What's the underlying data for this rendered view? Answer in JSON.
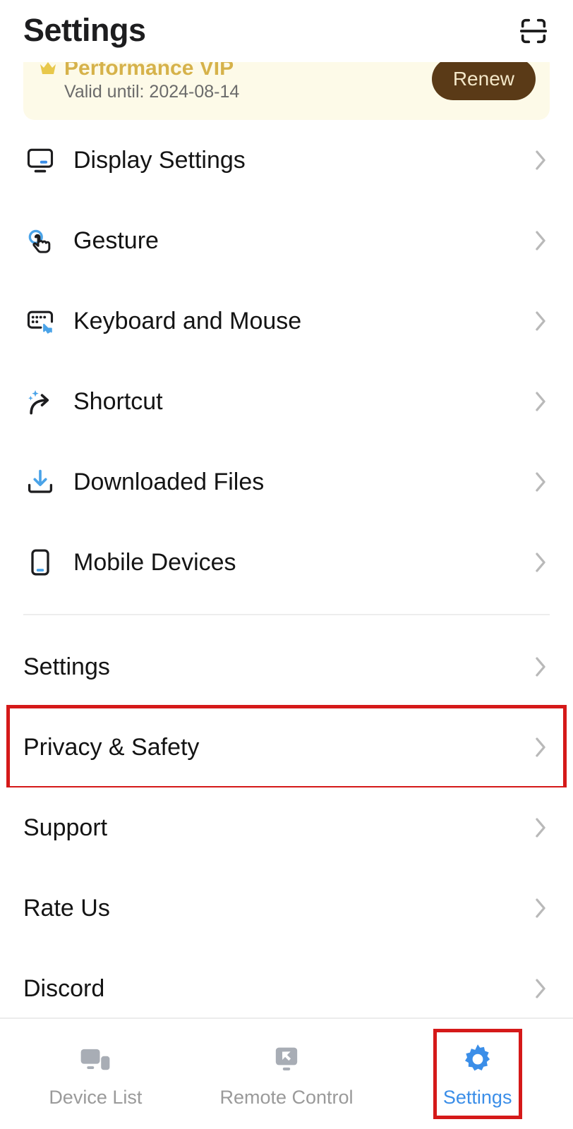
{
  "header": {
    "title": "Settings",
    "scan_icon": "scan-frame-icon"
  },
  "banner": {
    "icon": "crown-icon",
    "title": "Performance VIP",
    "valid_until": "Valid until: 2024-08-14",
    "renew_label": "Renew",
    "background_color": "#fdfae8",
    "button_color": "#5a3a17",
    "button_text_color": "#f3e7c8"
  },
  "menu": {
    "section_one": [
      {
        "label": "Display Settings",
        "icon": "monitor-icon"
      },
      {
        "label": "Gesture",
        "icon": "tap-gesture-icon"
      },
      {
        "label": "Keyboard and Mouse",
        "icon": "keyboard-cursor-icon"
      },
      {
        "label": "Shortcut",
        "icon": "curved-arrow-sparkle-icon"
      },
      {
        "label": "Downloaded Files",
        "icon": "download-tray-icon"
      },
      {
        "label": "Mobile Devices",
        "icon": "phone-icon"
      }
    ],
    "section_two": [
      {
        "label": "Settings",
        "highlighted": false
      },
      {
        "label": "Privacy & Safety",
        "highlighted": true
      },
      {
        "label": "Support",
        "highlighted": false
      },
      {
        "label": "Rate Us",
        "highlighted": false
      },
      {
        "label": "Discord",
        "highlighted": false
      }
    ],
    "chevron_icon": "chevron-right-icon"
  },
  "tabbar": {
    "items": [
      {
        "label": "Device List",
        "icon": "devices-icon",
        "active": false
      },
      {
        "label": "Remote Control",
        "icon": "remote-monitor-arrow-icon",
        "active": false
      },
      {
        "label": "Settings",
        "icon": "gear-icon",
        "active": true
      }
    ],
    "active_color": "#3b8ee8",
    "inactive_color": "#9a9a9a"
  },
  "highlight": {
    "color": "#d51919"
  }
}
